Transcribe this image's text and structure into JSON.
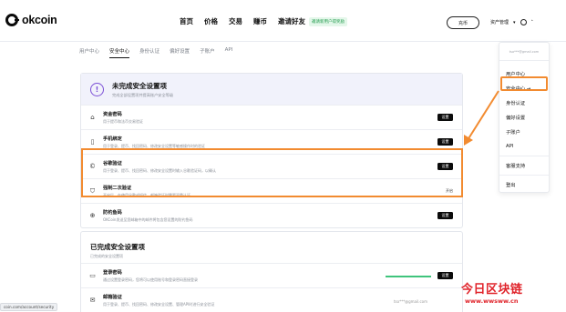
{
  "brand": {
    "logo_text": "okcoin"
  },
  "nav": {
    "items": [
      "首页",
      "价格",
      "交易",
      "赚币",
      "邀请好友"
    ],
    "invite_badge": "邀请新用户得奖励",
    "recharge_button": "充币",
    "assets_label": "资产管理"
  },
  "subnav": {
    "items": [
      "用户中心",
      "安全中心",
      "身份认证",
      "偏好设置",
      "子账户",
      "API"
    ]
  },
  "pending": {
    "title": "未完成安全设置项",
    "subtitle": "完成全部设置项并提高账户安全等级",
    "rows": [
      {
        "icon": "lock-icon",
        "title": "资金密码",
        "desc": "用于提币和法币交易验证",
        "action": "设置",
        "action_type": "button"
      },
      {
        "icon": "phone-icon",
        "title": "手机绑定",
        "desc": "用于登录、提币、找回密码、修改安全设置等敏感操作时的验证",
        "action": "设置",
        "action_type": "button"
      },
      {
        "icon": "google-auth-icon",
        "title": "谷歌验证",
        "desc": "用于登录、提币、找回密码、修改安全设置时输入谷歌验证码，以确认",
        "action": "设置",
        "action_type": "button"
      },
      {
        "icon": "shield-icon",
        "title": "强制二次验证",
        "desc": "开启后，在使用谷歌或短信、邮箱验证时需要双重认证",
        "action": "开启",
        "action_type": "link"
      },
      {
        "icon": "anti-phishing-icon",
        "title": "防钓鱼码",
        "desc": "OKCoin发送至您邮箱中的邮件将包含您设置的防钓鱼码",
        "action": "设置",
        "action_type": "button"
      }
    ]
  },
  "completed": {
    "title": "已完成安全设置项",
    "subtitle": "已完成的安全设置项",
    "rows": [
      {
        "icon": "login-password-icon",
        "title": "登录密码",
        "desc": "通过设置登录密码，您将可以使用账号和登录密码直接登录",
        "action": "设置",
        "value": ""
      },
      {
        "icon": "email-icon",
        "title": "邮箱验证",
        "desc": "用于登录、提币、找回密码、修改安全设置、管理API时进行安全验证",
        "action": "",
        "value": "tso***@gmail.com"
      }
    ]
  },
  "dropdown": {
    "email": "tso***@gmail.com",
    "items": [
      "用户中心",
      "安全中心 →",
      "身份认证",
      "偏好设置",
      "子账户",
      "API"
    ],
    "support": "客服支持",
    "logout": "登出"
  },
  "status_url": "coin.com/account/security",
  "watermark": {
    "title": "今日区块链",
    "url": "www.wwsww.cn"
  },
  "colors": {
    "highlight": "#f28b30",
    "accent_purple": "#7b4fd6",
    "progress_green": "#3fc47c"
  }
}
